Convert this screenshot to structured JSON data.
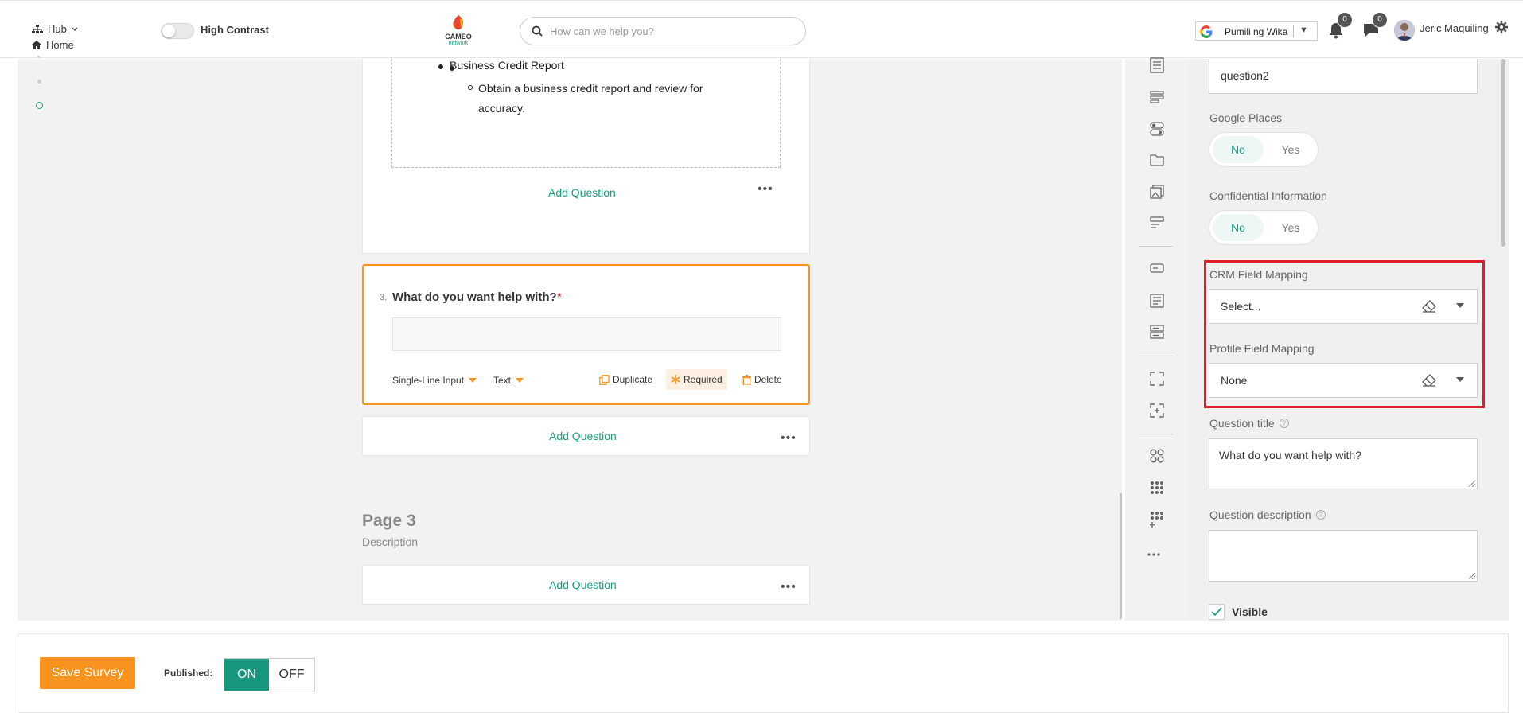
{
  "header": {
    "hub_label": "Hub",
    "home_label": "Home",
    "high_contrast_label": "High Contrast",
    "logo_text": "CAMEO",
    "logo_subtext": "network",
    "search_placeholder": "How can we help you?",
    "language_label": "Pumili ng Wika",
    "notifications_count": "0",
    "messages_count": "0",
    "user_name": "Jeric Maquiling"
  },
  "content": {
    "bullet_main": "Business Credit Report",
    "bullet_sub": "Obtain a business credit report and review for accuracy.",
    "add_question_1": "Add Question",
    "question_number": "3.",
    "question_title": "What do you want help with?",
    "required_star": "*",
    "question_type": "Single-Line Input",
    "question_subtype": "Text",
    "duplicate_label": "Duplicate",
    "required_label": "Required",
    "delete_label": "Delete",
    "add_question_2": "Add Question",
    "page_title": "Page 3",
    "page_description": "Description",
    "add_question_3": "Add Question"
  },
  "panel": {
    "name_value": "question2",
    "google_places_label": "Google Places",
    "google_places_no": "No",
    "google_places_yes": "Yes",
    "confidential_label": "Confidential Information",
    "confidential_no": "No",
    "confidential_yes": "Yes",
    "crm_label": "CRM Field Mapping",
    "crm_value": "Select...",
    "profile_label": "Profile Field Mapping",
    "profile_value": "None",
    "question_title_label": "Question title",
    "question_title_value": "What do you want help with?",
    "question_description_label": "Question description",
    "question_description_value": "",
    "visible_label": "Visible"
  },
  "footer": {
    "save_label": "Save Survey",
    "published_label": "Published:",
    "on_label": "ON",
    "off_label": "OFF"
  },
  "colors": {
    "accent_teal": "#1a9e84",
    "accent_orange": "#f7931e",
    "highlight_red": "#e01e25"
  }
}
